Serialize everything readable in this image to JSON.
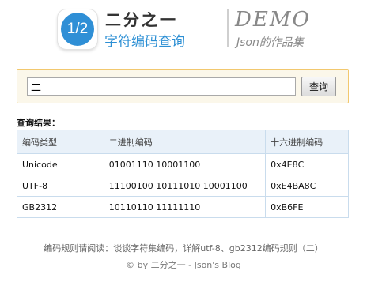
{
  "header": {
    "logo_text": "1/2",
    "title": "二分之一",
    "subtitle": "字符编码查询",
    "demo_title": "DEMO",
    "demo_subtitle": "Json的作品集"
  },
  "search": {
    "value": "二",
    "button_label": "查询"
  },
  "results": {
    "label": "查询结果：",
    "columns": [
      "编码类型",
      "二进制编码",
      "十六进制编码"
    ],
    "rows": [
      [
        "Unicode",
        "01001110 10001100",
        "0x4E8C"
      ],
      [
        "UTF-8",
        "11100100 10111010 10001100",
        "0xE4BA8C"
      ],
      [
        "GB2312",
        "10110110 11111110",
        "0xB6FE"
      ]
    ]
  },
  "footer": {
    "links_text": "编码规则请阅读：谈谈字符集编码，详解utf-8、gb2312编码规则（二）",
    "copyright": "© by 二分之一 - Json's Blog"
  }
}
